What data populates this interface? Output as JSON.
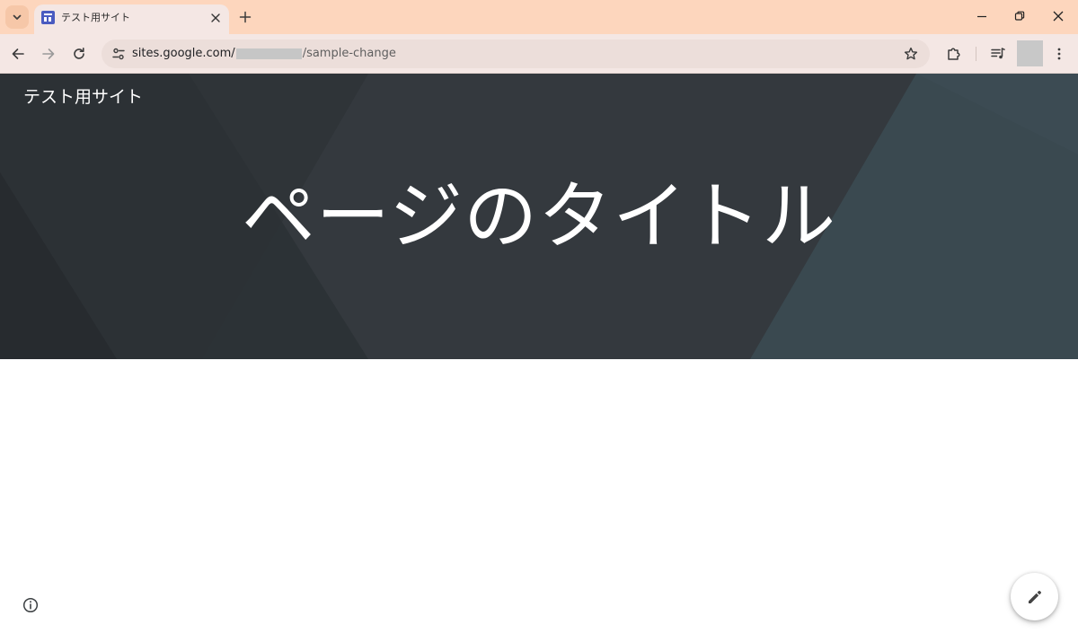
{
  "browser": {
    "tab": {
      "title": "テスト用サイト"
    },
    "address_bar": {
      "url_host": "sites.google.com/",
      "url_path": "/sample-change"
    },
    "colors": {
      "tab_strip": "#fdd6bd",
      "toolbar": "#f4e7e4",
      "favicon": "#4a5bc0"
    },
    "icons": {
      "tab_search": "chevron-down-icon",
      "tab_close": "close-icon",
      "new_tab": "plus-icon",
      "minimize": "minimize-icon",
      "restore": "restore-icon",
      "close_window": "close-icon",
      "back": "arrow-left-icon",
      "forward": "arrow-right-icon",
      "reload": "reload-icon",
      "site_info": "tune-icon",
      "bookmark": "star-icon",
      "extensions": "puzzle-icon",
      "media": "queue-music-icon",
      "menu": "more-vert-icon"
    }
  },
  "site": {
    "name": "テスト用サイト",
    "page_title": "ページのタイトル",
    "colors": {
      "hero_bg": "#33393e"
    },
    "icons": {
      "info": "info-icon",
      "edit": "pencil-icon"
    }
  }
}
